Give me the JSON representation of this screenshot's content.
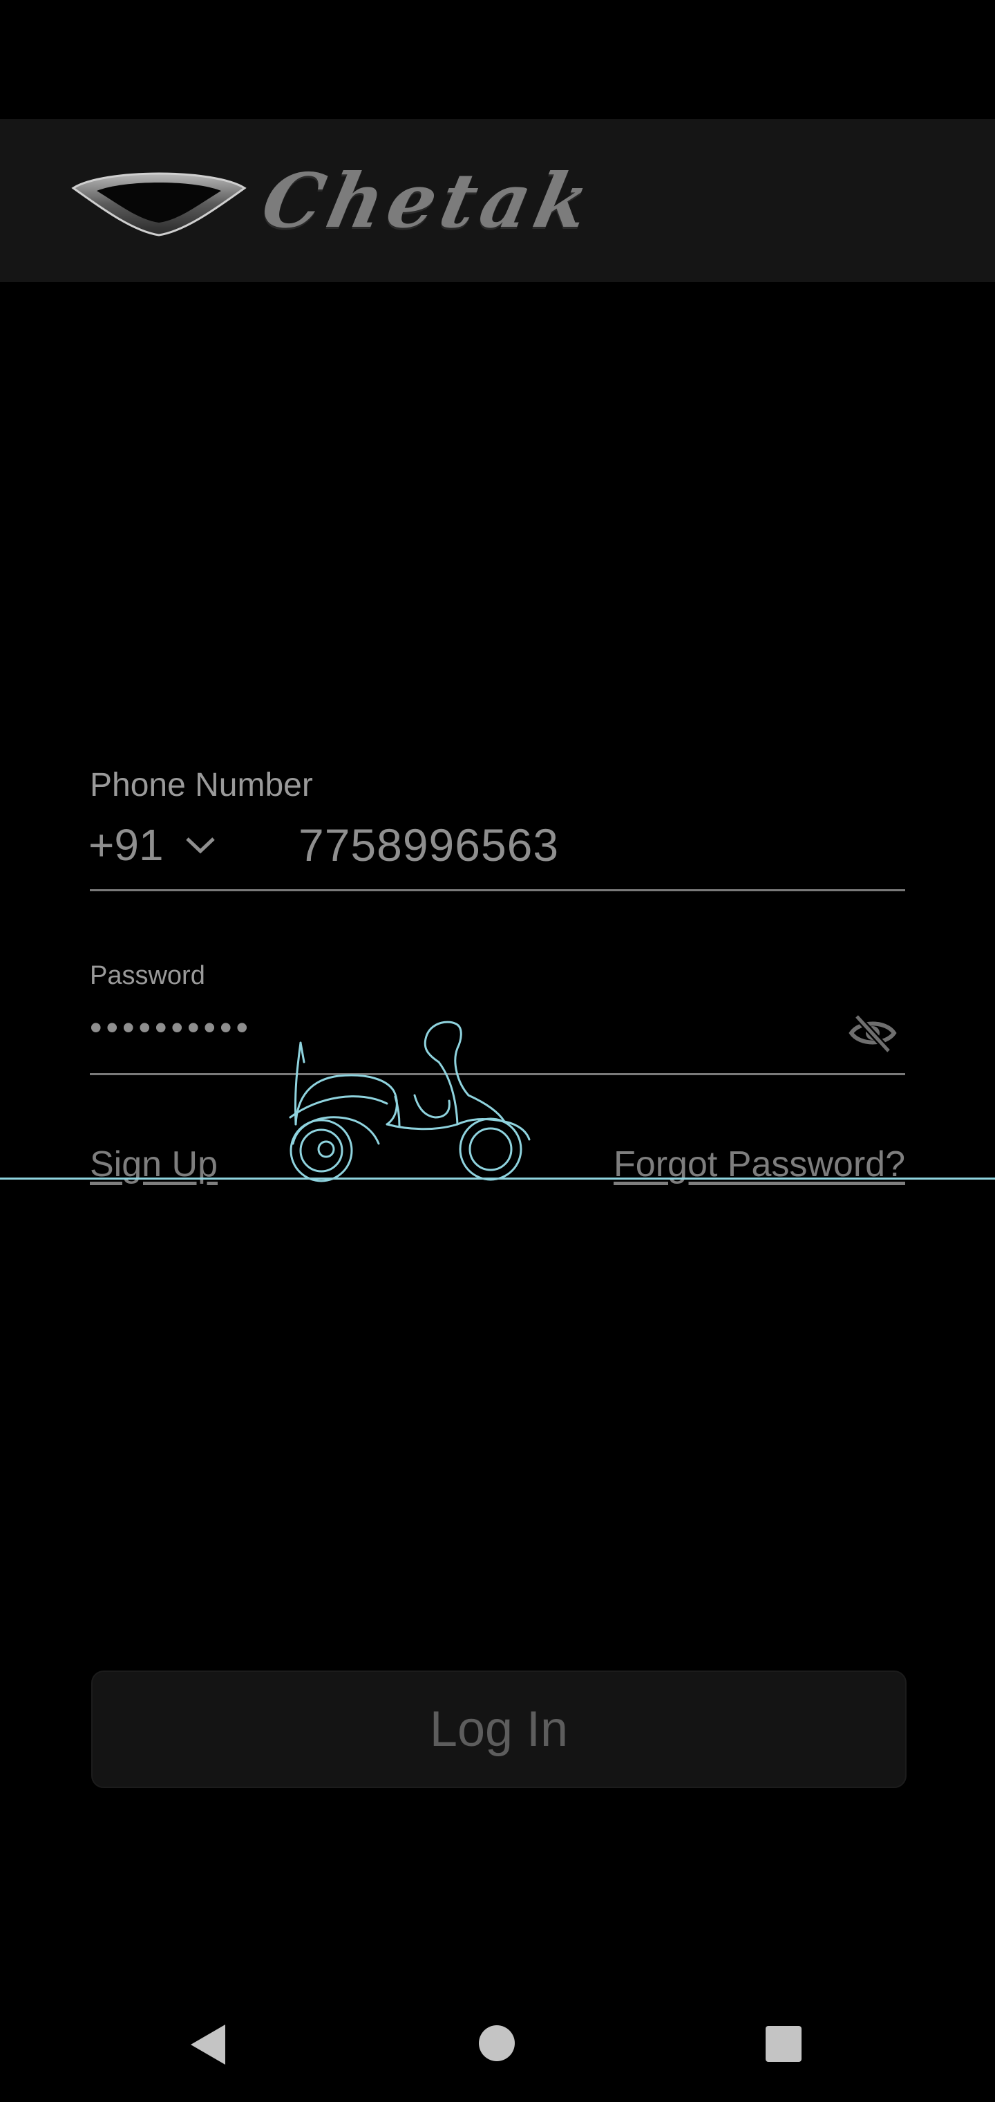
{
  "header": {
    "logo_text": "Chetak"
  },
  "login_form": {
    "phone": {
      "label": "Phone Number",
      "country_code": "+91",
      "value": "7758996563"
    },
    "password": {
      "label": "Password",
      "value": "••••••••••",
      "visibility_icon": "eye-off-icon"
    },
    "sign_up_link": "Sign Up",
    "forgot_password_link": "Forgot Password?",
    "login_button": "Log In"
  },
  "loading_indicator": {
    "icon": "scooter-icon",
    "line_color": "#8fd3de"
  },
  "navigation_bar": {
    "back_icon": "back-icon",
    "home_icon": "home-icon",
    "recents_icon": "recents-icon"
  },
  "colors": {
    "background": "#000000",
    "header_background": "#151515",
    "text": "#8a8a8a",
    "accent": "#8fd3de",
    "button_background": "#141414"
  }
}
